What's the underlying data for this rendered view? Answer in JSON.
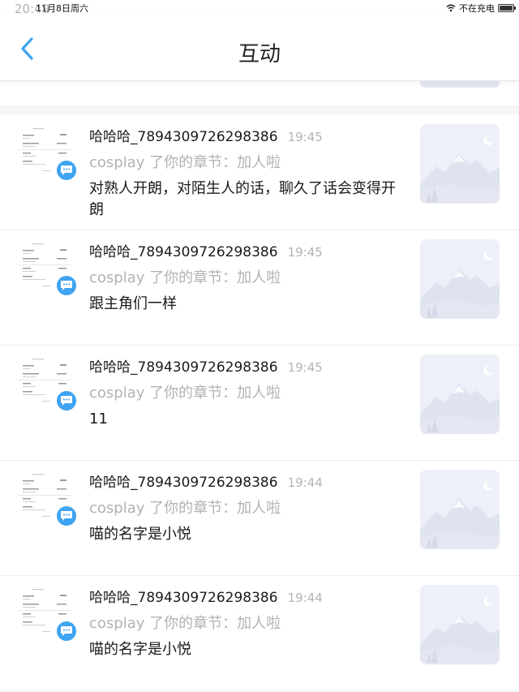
{
  "status_bar": {
    "time": "20:49",
    "date": "11月8日周六",
    "charging": "不在充电"
  },
  "header": {
    "title": "互动"
  },
  "items": [
    {
      "name": "哈哈哈_7894309726298386",
      "time": "19:45",
      "action": "cosplay 了你的章节：加人啦",
      "content": "对熟人开朗，对陌生人的话，聊久了话会变得开朗"
    },
    {
      "name": "哈哈哈_7894309726298386",
      "time": "19:45",
      "action": "cosplay 了你的章节：加人啦",
      "content": "跟主角们一样"
    },
    {
      "name": "哈哈哈_7894309726298386",
      "time": "19:45",
      "action": "cosplay 了你的章节：加人啦",
      "content": "11"
    },
    {
      "name": "哈哈哈_7894309726298386",
      "time": "19:44",
      "action": "cosplay 了你的章节：加人啦",
      "content": "喵的名字是小悦"
    },
    {
      "name": "哈哈哈_7894309726298386",
      "time": "19:44",
      "action": "cosplay 了你的章节：加人啦",
      "content": "喵的名字是小悦"
    }
  ],
  "icons": {
    "back": "back-arrow-icon",
    "comment": "comment-bubble-icon",
    "wifi": "wifi-icon",
    "battery": "battery-icon",
    "thumbnail": "mountain-landscape-placeholder"
  },
  "colors": {
    "accent": "#3fa4f1",
    "muted": "#b2b2b2",
    "text": "#1a1a1a"
  }
}
